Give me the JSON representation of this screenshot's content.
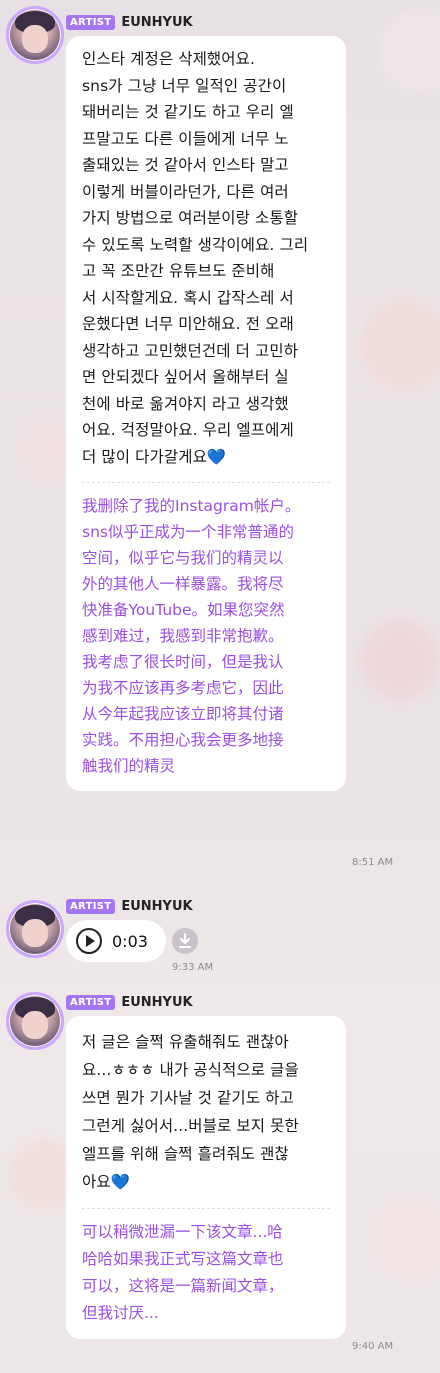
{
  "messages": [
    {
      "badge": "ARTIST",
      "sender": "EUNHYUK",
      "korean_lines": [
        "인스타 계정은 삭제했어요.",
        "sns가 그냥 너무 일적인 공간이",
        "돼버리는 것 같기도 하고 우리 엘",
        "프말고도 다른 이들에게 너무 노",
        "출돼있는 것 같아서 인스타 말고",
        "이렇게 버블이라던가, 다른 여러",
        "가지 방법으로 여러분이랑 소통할",
        "수 있도록 노력할 생각이에요. 그리",
        "고 꼭 조만간 유튜브도 준비해",
        "서 시작할게요. 혹시 갑작스레 서",
        "운했다면 너무 미안해요. 전 오래",
        "생각하고 고민했던건데 더 고민하",
        "면 안되겠다 싶어서 올해부터 실",
        "천에 바로 옮겨야지 라고 생각했",
        "어요. 걱정말아요. 우리 엘프에게",
        "더 많이 다가갈게요💙"
      ],
      "chinese_lines": [
        "我删除了我的Instagram帐户。",
        "sns似乎正成为一个非常普通的",
        "空间，似乎它与我们的精灵以",
        "外的其他人一样暴露。我将尽",
        "快准备YouTube。如果您突然",
        "感到难过，我感到非常抱歉。",
        "我考虑了很长时间，但是我认",
        "为我不应该再多考虑它，因此",
        "从今年起我应该立即将其付诸",
        "实践。不用担心我会更多地接",
        "触我们的精灵"
      ],
      "time": "8:51 AM"
    },
    {
      "badge": "ARTIST",
      "sender": "EUNHYUK",
      "voice_duration": "0:03",
      "time": "9:33 AM"
    },
    {
      "badge": "ARTIST",
      "sender": "EUNHYUK",
      "korean_lines": [
        "저 글은 슬쩍 유출해줘도 괜찮아",
        "요...ㅎㅎㅎ 내가 공식적으로 글을",
        "쓰면 뭔가 기사날 것 같기도 하고",
        "그런게 싫어서...버블로 보지 못한",
        "엘프를 위해 슬쩍 흘려줘도 괜찮",
        "아요💙"
      ],
      "chinese_lines": [
        "可以稍微泄漏一下该文章...哈",
        "哈哈如果我正式写这篇文章也",
        "可以，这将是一篇新闻文章，",
        "但我讨厌..."
      ],
      "time": "9:40 AM"
    }
  ],
  "icons": {
    "play": "play-icon",
    "download": "download-icon"
  },
  "colors": {
    "badge": "#a477f0",
    "translation_text": "#9b4fe0",
    "bubble": "#ffffff"
  }
}
